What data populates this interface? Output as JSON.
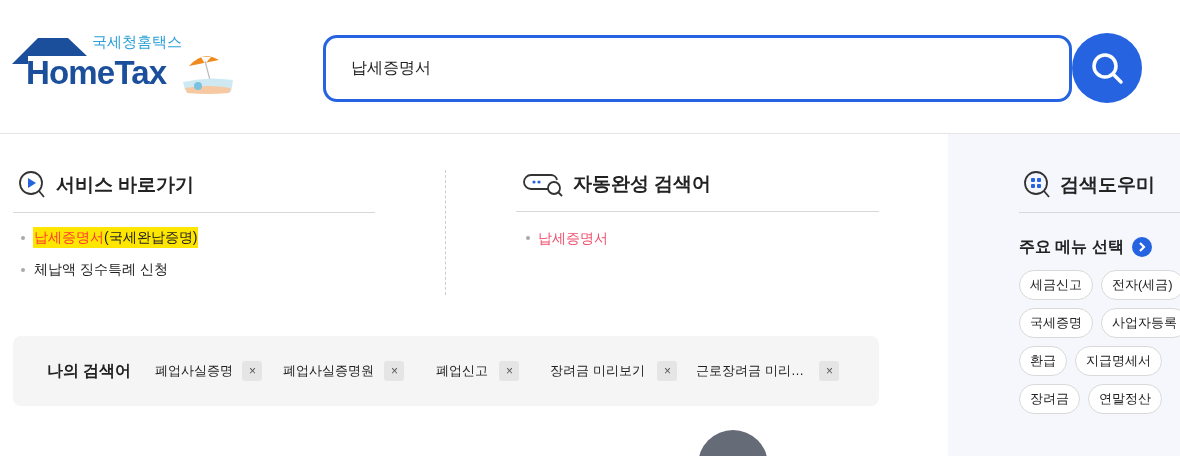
{
  "logo": {
    "subtitle": "국세청홈택스",
    "title": "HomeTax"
  },
  "search": {
    "value": "납세증명서"
  },
  "service_shortcuts": {
    "title": "서비스 바로가기",
    "items": [
      {
        "match": "납세증명서",
        "rest": "(국세완납증명)",
        "highlighted": true
      },
      {
        "rest": "체납액 징수특례 신청",
        "highlighted": false
      }
    ]
  },
  "autocomplete": {
    "title": "자동완성 검색어",
    "items": [
      "납세증명서"
    ]
  },
  "my_searches": {
    "title": "나의 검색어",
    "items": [
      {
        "label": "폐업사실증명",
        "remove": "×"
      },
      {
        "label": "폐업사실증명원",
        "remove": "×"
      },
      {
        "label": "폐업신고",
        "remove": "×"
      },
      {
        "label": "장려금 미리보기",
        "remove": "×"
      },
      {
        "label": "근로장려금 미리…",
        "remove": "×"
      }
    ]
  },
  "search_helper": {
    "title": "검색도우미",
    "subtitle": "주요 메뉴 선택",
    "chip_rows": [
      [
        "세금신고",
        "전자(세금)"
      ],
      [
        "국세증명",
        "사업자등록"
      ],
      [
        "환급",
        "지급명세서"
      ],
      [
        "장려금",
        "연말정산"
      ]
    ]
  }
}
